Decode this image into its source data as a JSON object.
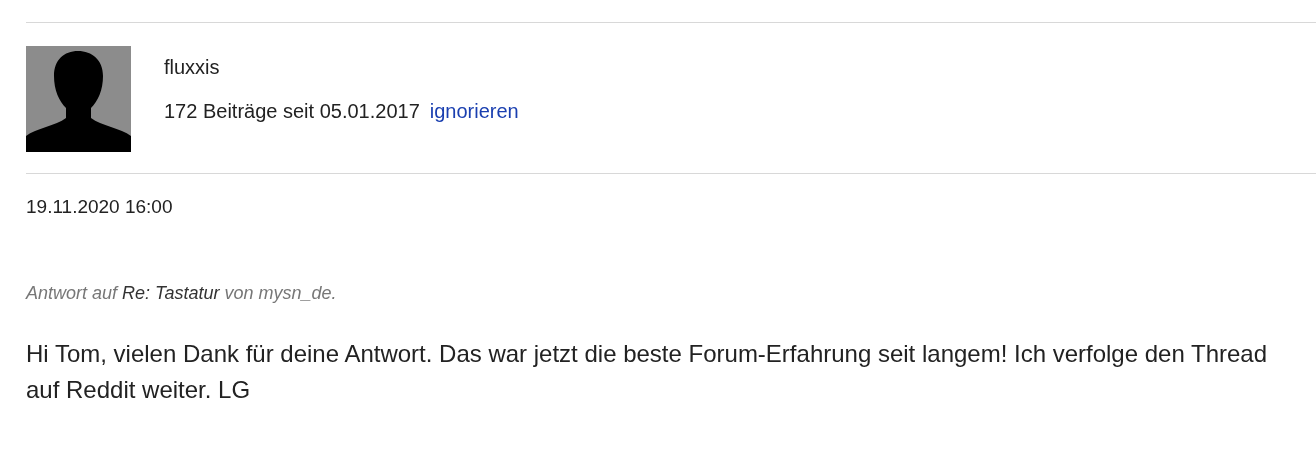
{
  "post": {
    "author": "fluxxis",
    "stats": "172 Beiträge seit 05.01.2017",
    "ignore_link": "ignorieren",
    "date": "19.11.2020 16:00",
    "reply_to": {
      "prefix": "Antwort auf",
      "link": "Re: Tastatur",
      "suffix": "von mysn_de."
    },
    "body": "Hi Tom, vielen Dank für deine Antwort. Das war jetzt die beste Forum-Erfahrung seit langem! Ich verfolge den Thread auf Reddit weiter. LG"
  }
}
